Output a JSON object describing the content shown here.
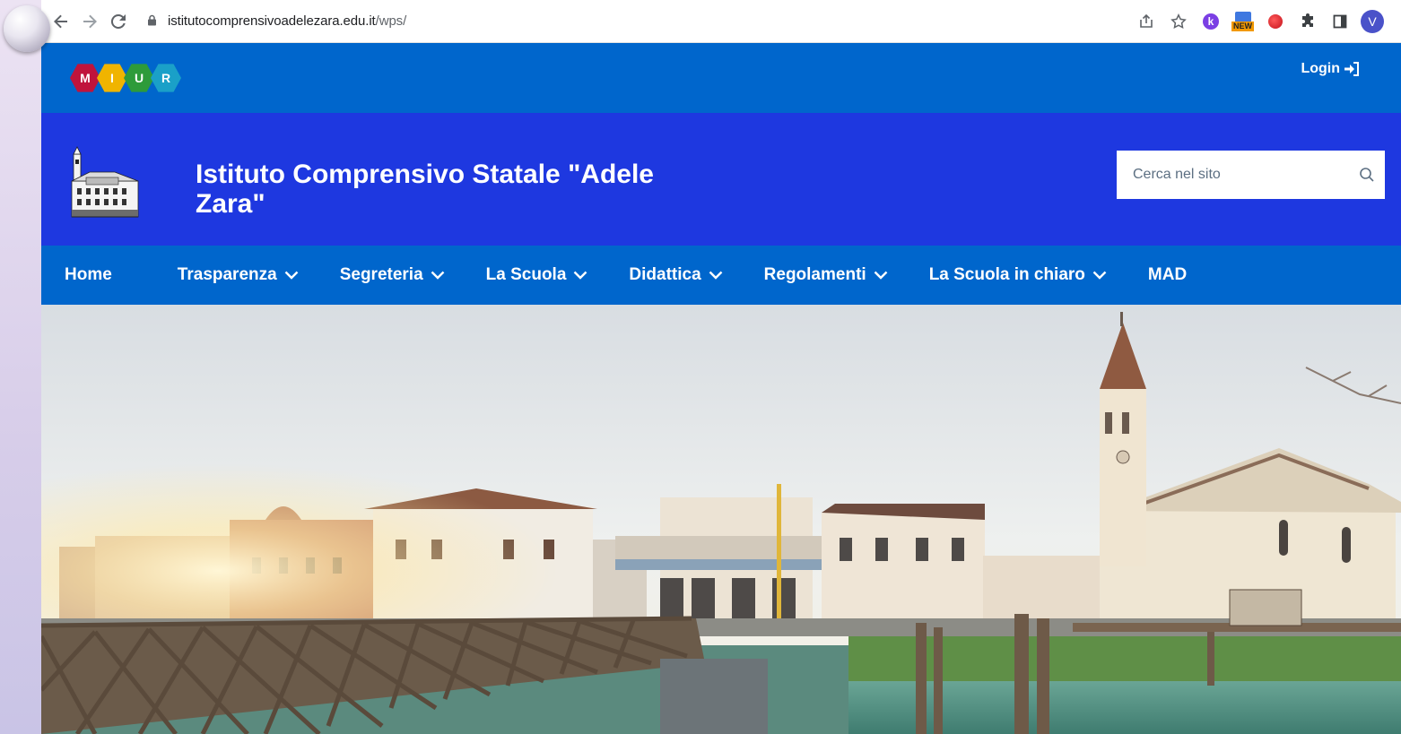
{
  "browser": {
    "url_host": "istitutocomprensivoadelezara.edu.it",
    "url_path": "/wps/",
    "extensions": [
      "share-icon",
      "star-icon",
      "k-extension-icon",
      "new-extension-icon",
      "red-extension-icon",
      "puzzle-icon",
      "sidebar-icon"
    ],
    "ext_k_label": "k",
    "ext_new_label": "NEW",
    "profile_initial": "V"
  },
  "topbar": {
    "logo_letters": [
      "M",
      "I",
      "U",
      "R"
    ],
    "logo_colors": [
      "#c0143c",
      "#f0b400",
      "#2e9b3a",
      "#1aa0c8"
    ],
    "login_label": "Login"
  },
  "header": {
    "title": "Istituto Comprensivo Statale \"Adele Zara\"",
    "search_placeholder": "Cerca nel sito"
  },
  "nav": {
    "items": [
      {
        "label": "Home",
        "dropdown": false
      },
      {
        "label": "Trasparenza",
        "dropdown": true
      },
      {
        "label": "Segreteria",
        "dropdown": true
      },
      {
        "label": "La Scuola",
        "dropdown": true
      },
      {
        "label": "Didattica",
        "dropdown": true
      },
      {
        "label": "Regolamenti",
        "dropdown": true
      },
      {
        "label": "La Scuola in chiaro",
        "dropdown": true
      },
      {
        "label": "MAD",
        "dropdown": false
      }
    ]
  },
  "colors": {
    "topbar": "#0066cc",
    "header": "#1e38e0",
    "nav": "#0066cc"
  }
}
